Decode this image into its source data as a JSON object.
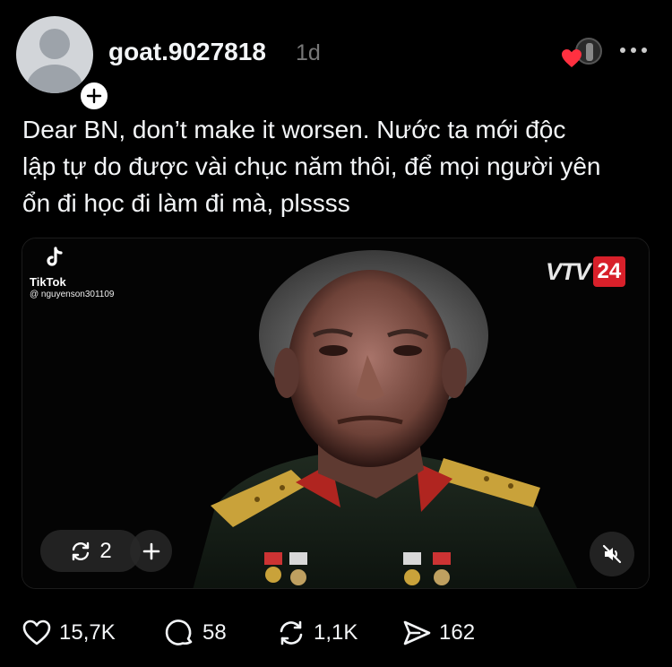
{
  "post": {
    "username": "goat.9027818",
    "time": "1d",
    "text_line1": "Dear BN, don’t make it worsen. Nước ta mới độc",
    "text_line2": "lập tự do được vài chục năm thôi, để mọi người yên",
    "text_line3": "ổn đi học đi làm đi mà, plssss"
  },
  "media": {
    "watermark_name": "TikTok",
    "watermark_handle": "@ nguyenson301109",
    "channel_logo_text": "VTV",
    "channel_logo_number": "24",
    "repost_count": "2"
  },
  "actions": {
    "likes": "15,7K",
    "replies": "58",
    "reposts": "1,1K",
    "shares": "162"
  },
  "colors": {
    "background": "#000000",
    "text": "#f3f5f7",
    "muted": "#777777",
    "heart": "#ff3040",
    "channel_red": "#d8202a"
  },
  "icons": {
    "like": "heart-icon",
    "reply": "comment-icon",
    "repost": "repost-icon",
    "share": "send-icon",
    "more": "more-options-icon",
    "mute": "speaker-muted-icon"
  }
}
